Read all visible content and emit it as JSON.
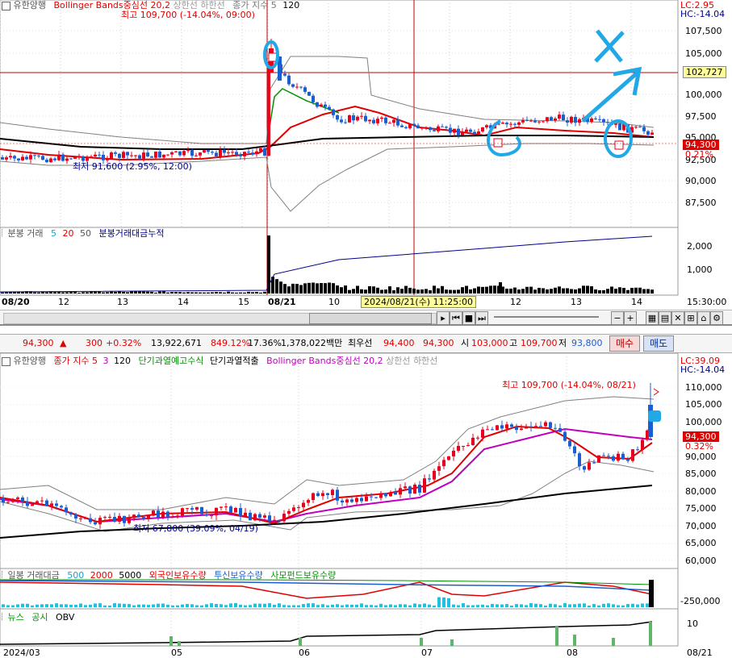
{
  "colors": {
    "up": "#e8001c",
    "down": "#1a5fd0",
    "ma_red": "#e00000",
    "ma_magenta": "#c000c0",
    "ma_black": "#000000",
    "bb_gray": "#808080",
    "accent_blue": "#00008b",
    "annotation": "#22a8e6",
    "price_box": "#ffff99"
  },
  "top_chart": {
    "legend": {
      "stock": "유한양행",
      "bb": "Bollinger Bands중심선 20,2",
      "upper": "상한선",
      "lower": "하한선",
      "close_ma": "종가 지수 5",
      "ma_val": "120"
    },
    "high_label": "최고 109,700 (-14.04%, 09:00)",
    "low_label": "최저 91,600 (2.95%, 12:00)",
    "lc_label": "LC:2.95",
    "hc_label": "HC:-14.04",
    "y_ticks": [
      "107,500",
      "105,000",
      "102,727",
      "100,000",
      "97,500",
      "95,000",
      "92,500",
      "90,000",
      "87,500"
    ],
    "current_price": "94,300",
    "current_pct": "0.21%",
    "crosshair_price": "102,727",
    "volume_legend": {
      "title": "분봉 거래",
      "v1": "5",
      "v2": "20",
      "v3": "50",
      "acc": "분봉거래대금누적"
    },
    "volume_ticks": [
      "2,000",
      "1,000"
    ],
    "x_ticks": [
      "08/20",
      "12",
      "13",
      "14",
      "15",
      "08/21",
      "10",
      "11",
      "12",
      "13",
      "14",
      "15"
    ],
    "cursor_date": "2024/08/21(수) 11:25:00",
    "right_time": "15:30:00"
  },
  "quote_bar": {
    "price": "94,300",
    "change": "300",
    "change_pct": "+0.32%",
    "volume": "13,922,671",
    "turnover_pct": "849.12%",
    "ratio": "17.36%",
    "amount": "1,378,022백만",
    "best_ask_label": "최우선",
    "best_ask": "94,400",
    "best_bid": "94,300",
    "open_label": "시",
    "open": "103,000",
    "high_label": "고",
    "high": "109,700",
    "low_label": "저",
    "low": "93,800",
    "buy": "매수",
    "sell": "매도"
  },
  "bottom_chart": {
    "legend": {
      "stock": "유한양행",
      "close_ma": "종가 지수 5",
      "v3": "3",
      "v120": "120",
      "short_warn": "단기과열예고수식",
      "short_hot": "단기과열적출",
      "bb": "Bollinger Bands중심선 20,2",
      "upper": "상한선",
      "lower": "하한선"
    },
    "lc_label": "LC:39.09",
    "hc_label": "HC:-14.04",
    "high_label": "최고 109,700 (-14.04%, 08/21)",
    "low_label": "최저 67,800 (39.09%, 04/19)",
    "y_ticks": [
      "110,000",
      "105,000",
      "100,000",
      "95,000",
      "90,000",
      "85,000",
      "80,000",
      "75,000",
      "70,000",
      "65,000",
      "60,000"
    ],
    "current_price": "94,300",
    "current_pct": "0.32%",
    "volume_legend": {
      "title": "일봉 거래대금",
      "v1": "500",
      "v2": "2000",
      "v3": "5000",
      "foreign": "외국인보유수량",
      "trust": "투신보유수량",
      "private": "사모펀드보유수량"
    },
    "volume_tick": "-250,000",
    "news_legend": {
      "news": "뉴스",
      "notice": "공시",
      "obv": "OBV"
    },
    "obv_tick": "10",
    "x_ticks": [
      "2024/03",
      "05",
      "06",
      "07",
      "08",
      "08/21"
    ]
  }
}
